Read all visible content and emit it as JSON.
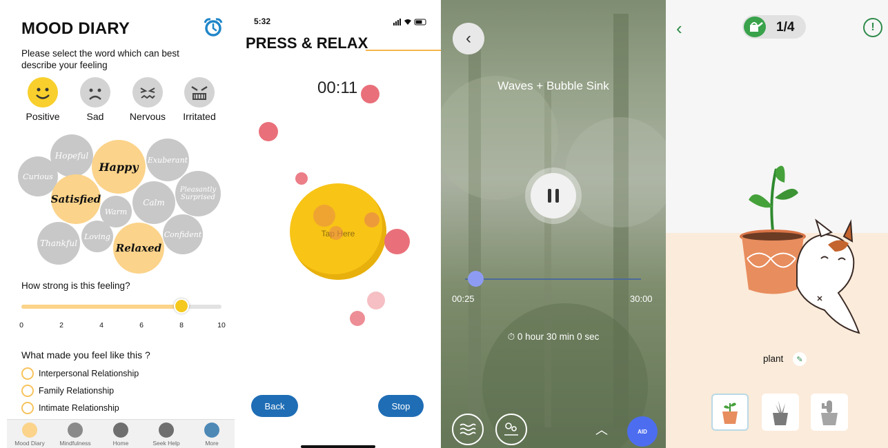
{
  "mood_diary": {
    "title": "MOOD DIARY",
    "prompt": "Please select the word which can best describe your feeling",
    "emotions": [
      {
        "label": "Positive",
        "color": "#f8cf2c"
      },
      {
        "label": "Sad",
        "color": "#d3d3d3"
      },
      {
        "label": "Nervous",
        "color": "#d3d3d3"
      },
      {
        "label": "Irritated",
        "color": "#d3d3d3"
      }
    ],
    "words": [
      "Hopeful",
      "Happy",
      "Exuberant",
      "Curious",
      "Satisfied",
      "Pleasantly Surprised",
      "Warm",
      "Calm",
      "Confident",
      "Thankful",
      "Loving",
      "Relaxed"
    ],
    "selected_words": [
      "Happy",
      "Satisfied",
      "Relaxed"
    ],
    "strength_question": "How strong is this feeling?",
    "strength_value": 8,
    "strength_max": 10,
    "ticks": [
      "0",
      "2",
      "4",
      "6",
      "8",
      "10"
    ],
    "cause_question": "What made you feel like this ?",
    "causes": [
      "Interpersonal Relationship",
      "Family Relationship",
      "Intimate Relationship"
    ],
    "tabs": [
      "Mood Diary",
      "Mindfulness",
      "Home",
      "Seek Help",
      "More"
    ],
    "accent": "#fbd38a"
  },
  "press_relax": {
    "status_time": "5:32",
    "title": "PRESS & RELAX",
    "timer": "00:11",
    "tap_label": "Tap Here",
    "back_label": "Back",
    "stop_label": "Stop",
    "button_color": "#1f6db5"
  },
  "player": {
    "track_title": "Waves + Bubble Sink",
    "elapsed": "00:25",
    "total": "30:00",
    "progress": 0.014,
    "duration_text": "0 hour 30 min 0 sec",
    "aid_label": "AID",
    "accent": "#4d6df0"
  },
  "garden": {
    "progress": "1/4",
    "plant_name": "plant",
    "accent": "#2f8a4a"
  }
}
